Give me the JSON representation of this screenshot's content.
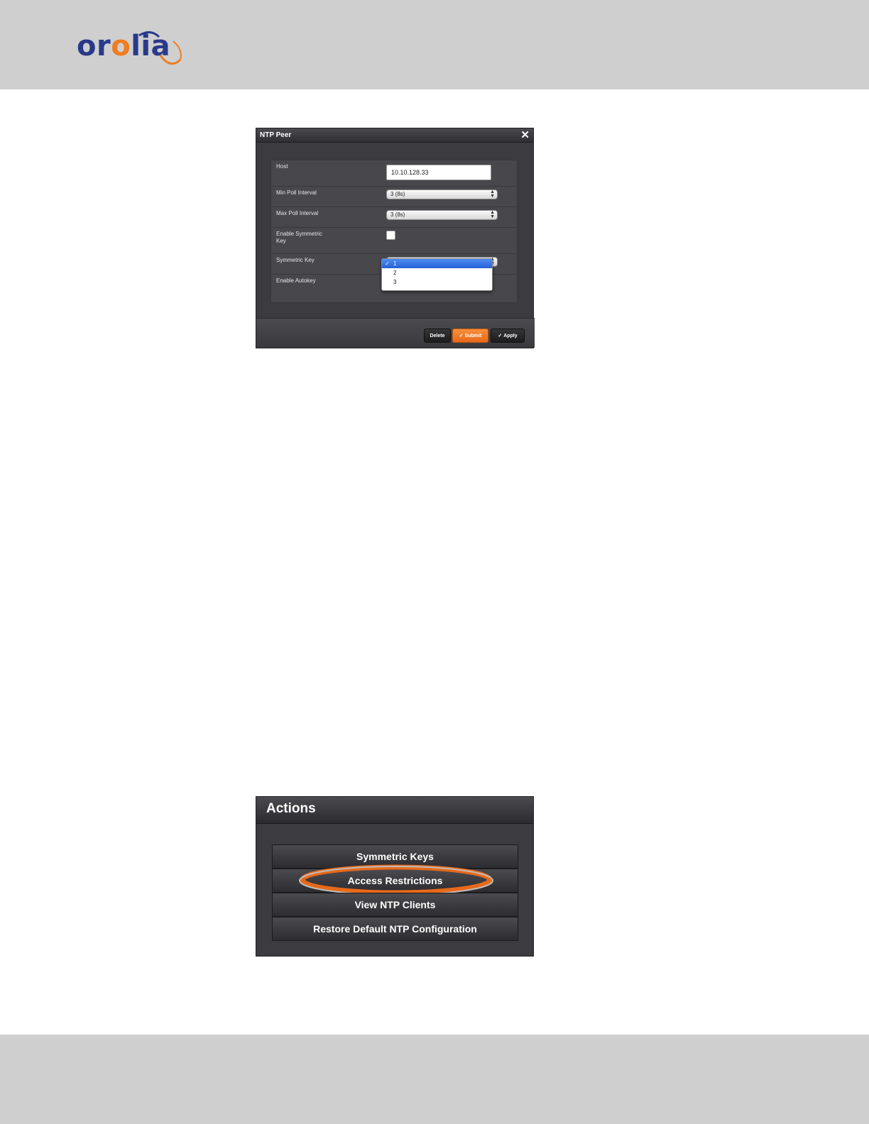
{
  "header": {
    "logo_text_1": "or",
    "logo_text_2": "o",
    "logo_text_3": "lia"
  },
  "dialog": {
    "title": "NTP Peer",
    "fields": {
      "host_label": "Host",
      "host_value": "10.10.128.33",
      "min_poll_label": "Min Poll Interval",
      "min_poll_value": "3 (8s)",
      "max_poll_label": "Max Poll Interval",
      "max_poll_value": "3 (8s)",
      "enable_symkey_label": "Enable Symmetric Key",
      "symkey_label": "Symmetric Key",
      "enable_autokey_label": "Enable Autokey"
    },
    "symkey_options": [
      "1",
      "2",
      "3"
    ],
    "symkey_selected": "1",
    "buttons": {
      "delete": "Delete",
      "submit": "Submit",
      "apply": "Apply"
    }
  },
  "actions": {
    "title": "Actions",
    "items": [
      "Symmetric Keys",
      "Access Restrictions",
      "View NTP Clients",
      "Restore Default NTP Configuration"
    ],
    "highlighted": "Access Restrictions"
  },
  "colors": {
    "brand_blue": "#2a3a8a",
    "brand_orange": "#ef7d22",
    "accent": "#f07d22",
    "selection": "#2f6ae0"
  }
}
